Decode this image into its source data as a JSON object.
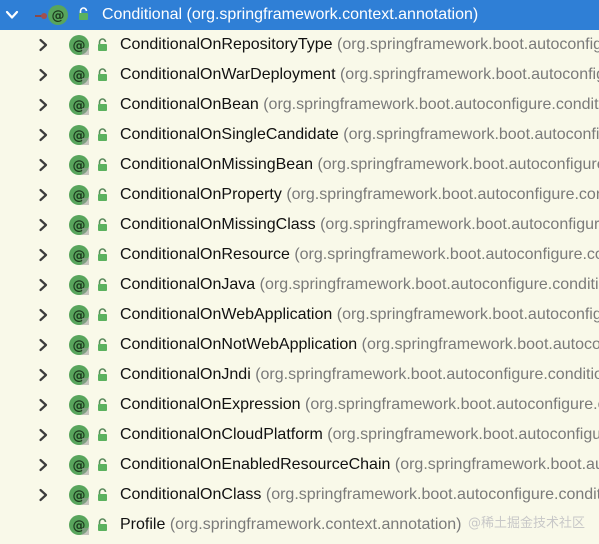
{
  "selected": {
    "name": "Conditional",
    "package": "(org.springframework.context.annotation)",
    "icon": "annotation-icon"
  },
  "items": [
    {
      "name": "ConditionalOnRepositoryType",
      "package": "(org.springframework.boot.autoconfigure.data)",
      "expandable": true
    },
    {
      "name": "ConditionalOnWarDeployment",
      "package": "(org.springframework.boot.autoconfigure.condition)",
      "expandable": true
    },
    {
      "name": "ConditionalOnBean",
      "package": "(org.springframework.boot.autoconfigure.condition)",
      "expandable": true
    },
    {
      "name": "ConditionalOnSingleCandidate",
      "package": "(org.springframework.boot.autoconfigure.condition)",
      "expandable": true
    },
    {
      "name": "ConditionalOnMissingBean",
      "package": "(org.springframework.boot.autoconfigure.condition)",
      "expandable": true
    },
    {
      "name": "ConditionalOnProperty",
      "package": "(org.springframework.boot.autoconfigure.condition)",
      "expandable": true
    },
    {
      "name": "ConditionalOnMissingClass",
      "package": "(org.springframework.boot.autoconfigure.condition)",
      "expandable": true
    },
    {
      "name": "ConditionalOnResource",
      "package": "(org.springframework.boot.autoconfigure.condition)",
      "expandable": true
    },
    {
      "name": "ConditionalOnJava",
      "package": "(org.springframework.boot.autoconfigure.condition)",
      "expandable": true
    },
    {
      "name": "ConditionalOnWebApplication",
      "package": "(org.springframework.boot.autoconfigure.condition)",
      "expandable": true
    },
    {
      "name": "ConditionalOnNotWebApplication",
      "package": "(org.springframework.boot.autoconfigure.condition)",
      "expandable": true
    },
    {
      "name": "ConditionalOnJndi",
      "package": "(org.springframework.boot.autoconfigure.condition)",
      "expandable": true
    },
    {
      "name": "ConditionalOnExpression",
      "package": "(org.springframework.boot.autoconfigure.condition)",
      "expandable": true
    },
    {
      "name": "ConditionalOnCloudPlatform",
      "package": "(org.springframework.boot.autoconfigure.condition)",
      "expandable": true
    },
    {
      "name": "ConditionalOnEnabledResourceChain",
      "package": "(org.springframework.boot.autoconfigure.web)",
      "expandable": true
    },
    {
      "name": "ConditionalOnClass",
      "package": "(org.springframework.boot.autoconfigure.condition)",
      "expandable": true
    },
    {
      "name": "Profile",
      "package": "(org.springframework.context.annotation)",
      "expandable": false
    }
  ],
  "watermark": "@稀土掘金技术社区",
  "colors": {
    "background": "#f9f9e9",
    "selection": "#2f7fd6",
    "annotation_icon": "#58a55c",
    "lock_icon": "#5bb25f",
    "package_text": "#7a7a7a"
  }
}
